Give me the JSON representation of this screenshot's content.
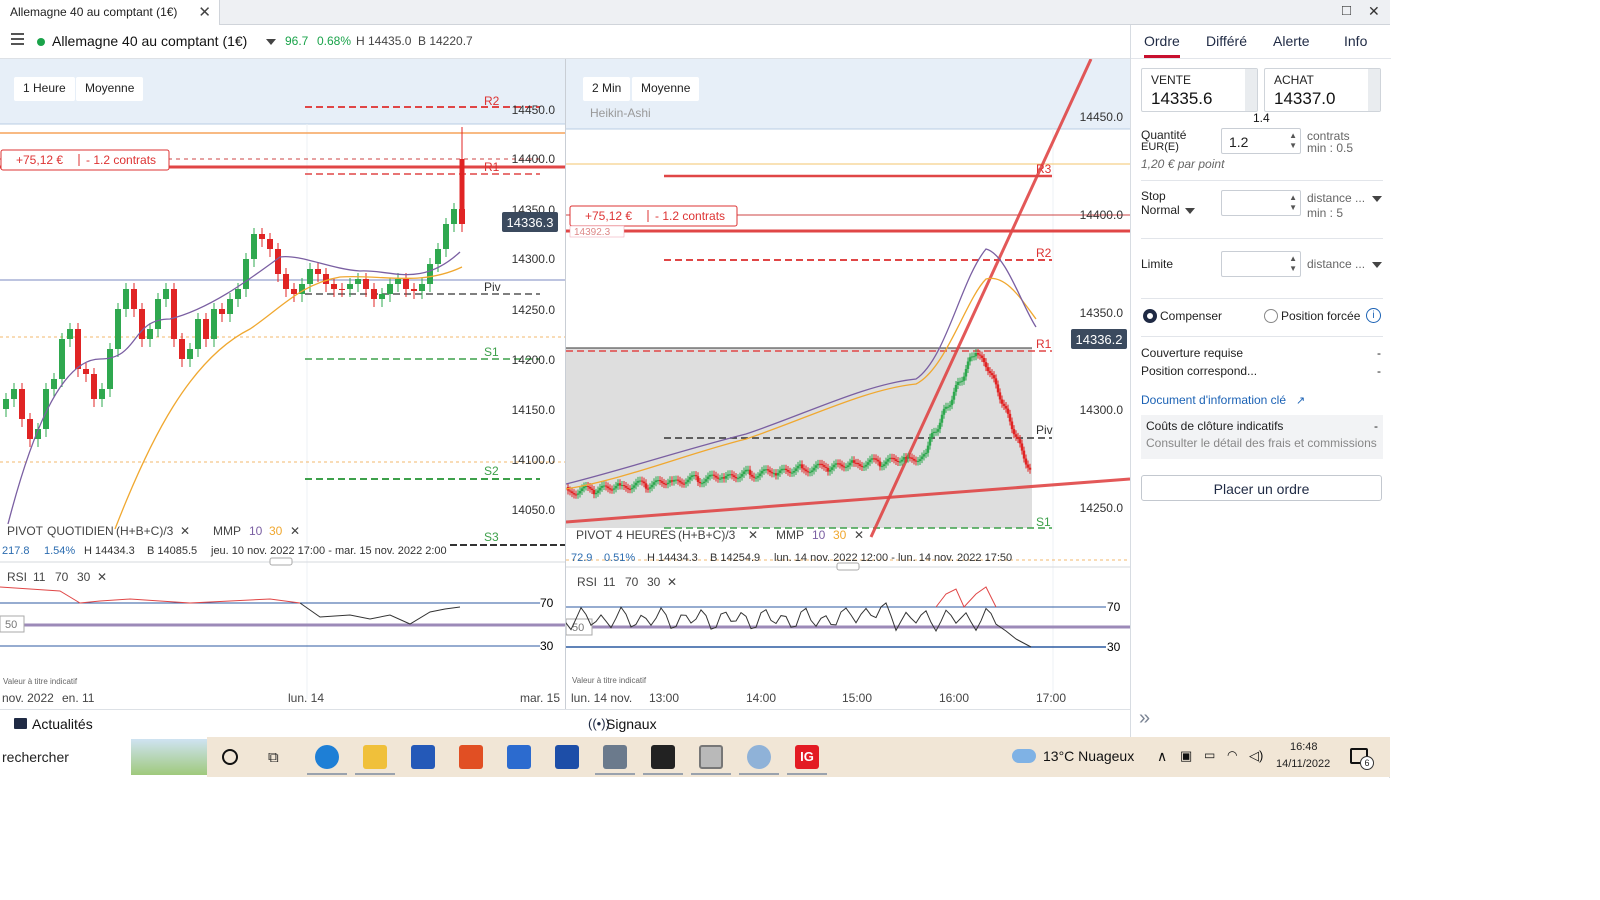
{
  "window": {
    "tab_title": "Allemagne 40 au comptant (1€)",
    "tab_close": "✕",
    "maximize_icon": "□",
    "close_icon": "✕"
  },
  "header": {
    "instrument": "Allemagne 40 au comptant (1€)",
    "change": "96.7",
    "change_pct": "0.68%",
    "high": "H 14435.0",
    "low": "B 14220.7",
    "status_color": "#1aa34a"
  },
  "chart_left": {
    "interval_button": "1 Heure",
    "indicator_button": "Moyenne",
    "position_pl": "+75,12 €",
    "position_size": "- 1.2 contrats",
    "last_price": "14336.3",
    "y_ticks": [
      "14450.0",
      "14400.0",
      "14350.0",
      "14300.0",
      "14250.0",
      "14200.0",
      "14150.0",
      "14100.0",
      "14050.0"
    ],
    "pivot_labels": [
      "R2",
      "R1",
      "Piv",
      "S1",
      "S2",
      "S3"
    ],
    "pivot_legend": [
      "PIVOT",
      "QUOTIDIEN",
      "(H+B+C)/3",
      "MMP",
      "10",
      "30"
    ],
    "stats": [
      "217.8",
      "1.54%",
      "H 14434.3",
      "B 14085.5",
      "jeu. 10 nov. 2022 17:00 - mar. 15 nov. 2022 2:00"
    ],
    "rsi_legend": [
      "RSI",
      "11",
      "70",
      "30"
    ],
    "rsi_levels": [
      "70",
      "50",
      "30"
    ],
    "disclaimer": "Valeur à titre indicatif",
    "x_labels": [
      "nov. 2022",
      "en. 11",
      "lun. 14",
      "mar. 15"
    ]
  },
  "chart_right": {
    "interval_button": "2 Min",
    "indicator_button": "Moyenne",
    "chart_type": "Heikin-Ashi",
    "position_pl": "+75,12 €",
    "position_size": "- 1.2 contrats",
    "entry_price": "14392.3",
    "last_price": "14336.2",
    "y_ticks": [
      "14450.0",
      "14400.0",
      "14350.0",
      "14300.0",
      "14250.0"
    ],
    "pivot_labels": [
      "R3",
      "R2",
      "R1",
      "Piv",
      "S1"
    ],
    "pivot_legend": [
      "PIVOT",
      "4 HEURES",
      "(H+B+C)/3",
      "MMP",
      "10",
      "30"
    ],
    "stats": [
      "72.9",
      "0.51%",
      "H 14434.3",
      "B 14254.9",
      "lun. 14 nov. 2022 12:00 - lun. 14 nov. 2022 17:50"
    ],
    "rsi_legend": [
      "RSI",
      "11",
      "70",
      "30"
    ],
    "rsi_levels": [
      "70",
      "50",
      "30"
    ],
    "disclaimer": "Valeur à titre indicatif",
    "x_labels": [
      "lun. 14 nov.",
      "13:00",
      "14:00",
      "15:00",
      "16:00",
      "17:00"
    ]
  },
  "panel": {
    "tabs": [
      "Ordre",
      "Différé",
      "Alerte",
      "Info"
    ],
    "sell_label": "VENTE",
    "sell_price": "14335.6",
    "buy_label": "ACHAT",
    "buy_price": "14337.0",
    "spread": "1.4",
    "quantity_label": "Quantité",
    "quantity_currency": "EUR(E)",
    "quantity_value": "1.2",
    "quantity_unit": "contrats",
    "quantity_min": "min : 0.5",
    "per_point": "1,20 € par point",
    "stop_label": "Stop",
    "stop_type": "Normal",
    "stop_distance": "distance ...",
    "stop_min": "min : 5",
    "limit_label": "Limite",
    "limit_distance": "distance ...",
    "radio_compenser": "Compenser",
    "radio_forcee": "Position forcée",
    "info_icon": "i",
    "margin_label": "Couverture requise",
    "margin_value": "-",
    "position_label": "Position correspond...",
    "position_value": "-",
    "doc_link": "Document d'information clé",
    "costs_title": "Coûts de clôture indicatifs",
    "costs_value": "-",
    "costs_sub": "Consulter le détail des frais et commissions",
    "place_order": "Placer un ordre"
  },
  "footer": {
    "news": "Actualités",
    "signals": "Signaux",
    "collapse_icon": "»"
  },
  "taskbar": {
    "search": "rechercher",
    "weather": "13°C  Nuageux",
    "time": "16:48",
    "date": "14/11/2022",
    "notifications": "6"
  }
}
